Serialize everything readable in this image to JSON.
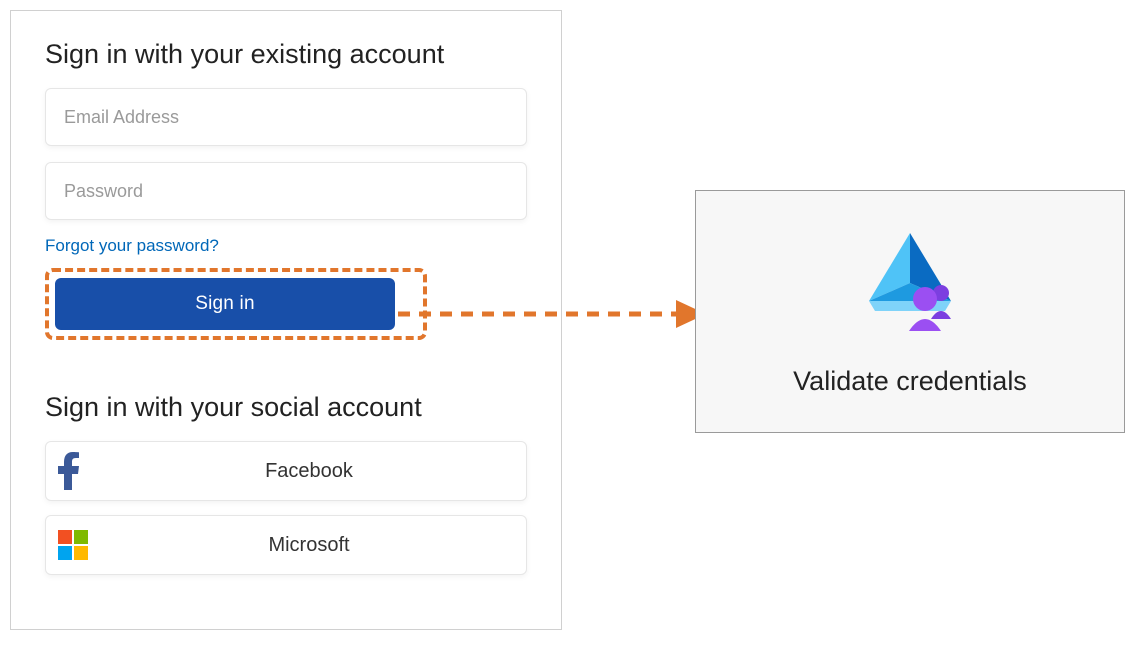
{
  "signin": {
    "title": "Sign in with your existing account",
    "email_placeholder": "Email Address",
    "password_placeholder": "Password",
    "forgot_label": "Forgot your password?",
    "signin_button_label": "Sign in"
  },
  "social": {
    "title": "Sign in with your social account",
    "facebook_label": "Facebook",
    "microsoft_label": "Microsoft"
  },
  "validate": {
    "caption": "Validate credentials"
  },
  "colors": {
    "highlight": "#e1762c",
    "primary_button": "#184fa9",
    "link": "#0067b8"
  }
}
